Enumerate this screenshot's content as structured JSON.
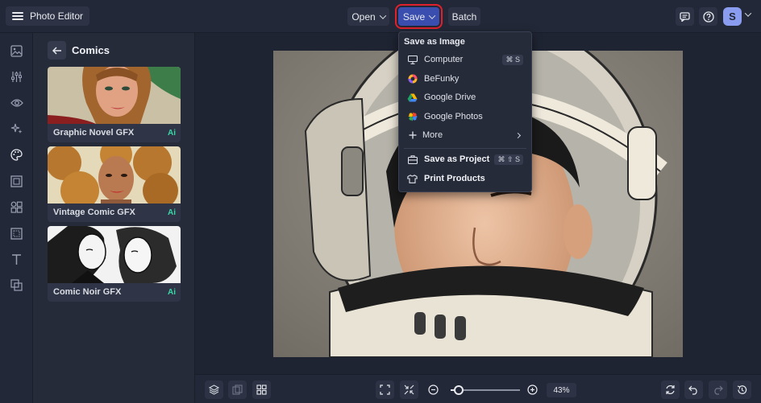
{
  "app": {
    "title": "Photo Editor"
  },
  "toolbar": {
    "open_label": "Open",
    "save_label": "Save",
    "batch_label": "Batch",
    "avatar_initial": "S"
  },
  "rail": {
    "items": [
      "image-icon",
      "sliders-icon",
      "eye-icon",
      "sparkle-icon",
      "palette-icon",
      "frame-icon",
      "shapes-icon",
      "texture-icon",
      "text-icon",
      "layers-icon"
    ]
  },
  "panel": {
    "title": "Comics",
    "cards": [
      {
        "label": "Graphic Novel GFX",
        "badge": "Ai"
      },
      {
        "label": "Vintage Comic GFX",
        "badge": "Ai"
      },
      {
        "label": "Comic Noir GFX",
        "badge": "Ai"
      }
    ]
  },
  "save_menu": {
    "heading": "Save as Image",
    "items": [
      {
        "label": "Computer",
        "shortcut": "⌘ S",
        "icon": "monitor-icon"
      },
      {
        "label": "BeFunky",
        "shortcut": "",
        "icon": "befunky-icon"
      },
      {
        "label": "Google Drive",
        "shortcut": "",
        "icon": "google-drive-icon"
      },
      {
        "label": "Google Photos",
        "shortcut": "",
        "icon": "google-photos-icon"
      },
      {
        "label": "More",
        "shortcut": "",
        "icon": "plus-icon"
      }
    ],
    "project_items": [
      {
        "label": "Save as Project",
        "shortcut": "⌘ ⇧ S",
        "icon": "briefcase-icon"
      },
      {
        "label": "Print Products",
        "shortcut": "",
        "icon": "shirt-icon"
      }
    ]
  },
  "zoom": {
    "value_label": "43%",
    "level": 0.12
  },
  "colors": {
    "accent": "#3a4eb0",
    "highlight": "#e0212b",
    "ai_badge": "#38d6a8",
    "avatar": "#8a9cf0"
  }
}
